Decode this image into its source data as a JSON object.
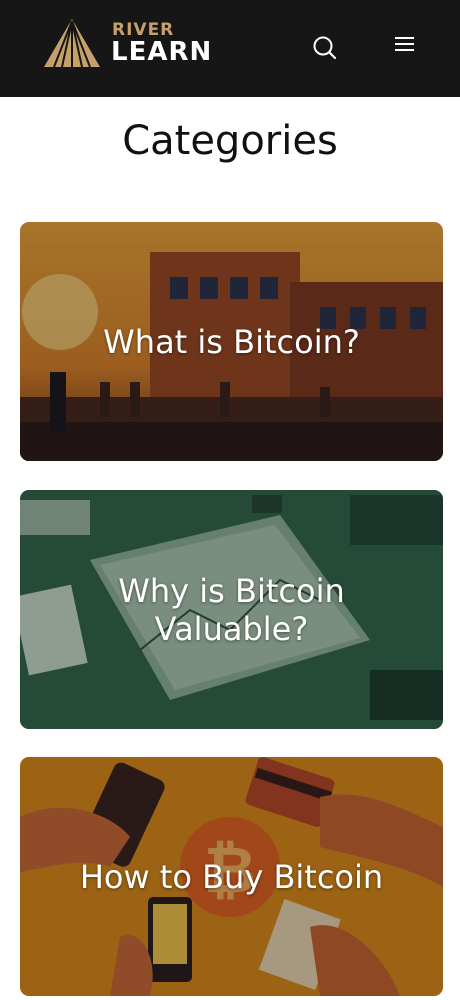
{
  "header": {
    "logo_top": "RIVER",
    "logo_bottom": "LEARN",
    "brand_gold": "#c5a06a",
    "background": "#161616",
    "search_icon": "search-icon",
    "menu_icon": "hamburger-menu-icon"
  },
  "main": {
    "title": "Categories",
    "cards": [
      {
        "label": "What is Bitcoin?",
        "tint": "#c2762a"
      },
      {
        "label": "Why is Bitcoin Valuable?",
        "tint": "#2f6a4f"
      },
      {
        "label": "How to Buy Bitcoin",
        "tint": "#d88a1a"
      }
    ]
  }
}
